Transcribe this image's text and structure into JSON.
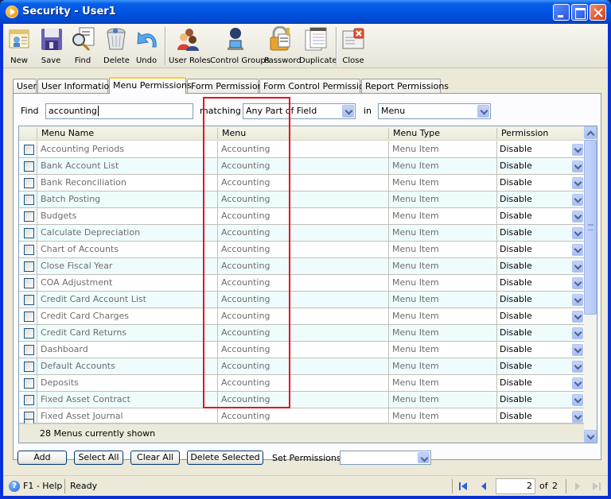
{
  "window": {
    "title": "Security - User1"
  },
  "toolbar": {
    "buttons": [
      {
        "label": "New",
        "icon": "new-document-icon"
      },
      {
        "label": "Save",
        "icon": "floppy-disk-icon"
      },
      {
        "label": "Find",
        "icon": "magnifier-icon"
      },
      {
        "label": "Delete",
        "icon": "trash-can-icon"
      },
      {
        "label": "Undo",
        "icon": "undo-arrow-icon"
      },
      {
        "label": "User Roles",
        "icon": "users-icon"
      },
      {
        "label": "Control Groups",
        "icon": "user-computer-icon"
      },
      {
        "label": "Password",
        "icon": "padlock-key-icon"
      },
      {
        "label": "Duplicate",
        "icon": "duplicate-pages-icon"
      },
      {
        "label": "Close",
        "icon": "close-window-icon"
      }
    ]
  },
  "tabs": [
    {
      "label": "User",
      "active": false
    },
    {
      "label": "User Information",
      "active": false
    },
    {
      "label": "Menu Permissions",
      "active": true
    },
    {
      "label": "Form Permissions",
      "active": false
    },
    {
      "label": "Form Control Permissions",
      "active": false
    },
    {
      "label": "Report Permissions",
      "active": false
    }
  ],
  "filter": {
    "find_label": "Find",
    "find_value": "accounting",
    "matching_label": "matching",
    "matching_value": "Any Part of Field",
    "in_label": "in",
    "in_value": "Menu"
  },
  "grid": {
    "columns": [
      "Menu Name",
      "Menu",
      "Menu Type",
      "Permission"
    ],
    "rows": [
      {
        "name": "Accounting Periods",
        "menu": "Accounting",
        "type": "Menu Item",
        "permission": "Disable"
      },
      {
        "name": "Bank Account List",
        "menu": "Accounting",
        "type": "Menu Item",
        "permission": "Disable"
      },
      {
        "name": "Bank Reconciliation",
        "menu": "Accounting",
        "type": "Menu Item",
        "permission": "Disable"
      },
      {
        "name": "Batch Posting",
        "menu": "Accounting",
        "type": "Menu Item",
        "permission": "Disable"
      },
      {
        "name": "Budgets",
        "menu": "Accounting",
        "type": "Menu Item",
        "permission": "Disable"
      },
      {
        "name": "Calculate Depreciation",
        "menu": "Accounting",
        "type": "Menu Item",
        "permission": "Disable"
      },
      {
        "name": "Chart of Accounts",
        "menu": "Accounting",
        "type": "Menu Item",
        "permission": "Disable"
      },
      {
        "name": "Close Fiscal Year",
        "menu": "Accounting",
        "type": "Menu Item",
        "permission": "Disable"
      },
      {
        "name": "COA Adjustment",
        "menu": "Accounting",
        "type": "Menu Item",
        "permission": "Disable"
      },
      {
        "name": "Credit Card Account List",
        "menu": "Accounting",
        "type": "Menu Item",
        "permission": "Disable"
      },
      {
        "name": "Credit Card Charges",
        "menu": "Accounting",
        "type": "Menu Item",
        "permission": "Disable"
      },
      {
        "name": "Credit Card Returns",
        "menu": "Accounting",
        "type": "Menu Item",
        "permission": "Disable"
      },
      {
        "name": "Dashboard",
        "menu": "Accounting",
        "type": "Menu Item",
        "permission": "Disable"
      },
      {
        "name": "Default Accounts",
        "menu": "Accounting",
        "type": "Menu Item",
        "permission": "Disable"
      },
      {
        "name": "Deposits",
        "menu": "Accounting",
        "type": "Menu Item",
        "permission": "Disable"
      },
      {
        "name": "Fixed Asset Contract",
        "menu": "Accounting",
        "type": "Menu Item",
        "permission": "Disable"
      },
      {
        "name": "Fixed Asset Journal",
        "menu": "Accounting",
        "type": "Menu Item",
        "permission": "Disable"
      }
    ],
    "footer": "28 Menus currently shown"
  },
  "actions": {
    "add": "Add",
    "select_all": "Select All",
    "clear_all": "Clear All",
    "delete_selected": "Delete Selected",
    "set_permissions_label": "Set Permissions",
    "set_permissions_value": ""
  },
  "status": {
    "help": "F1 - Help",
    "state": "Ready",
    "page": "2",
    "of_label": "of",
    "total_pages": "2"
  }
}
